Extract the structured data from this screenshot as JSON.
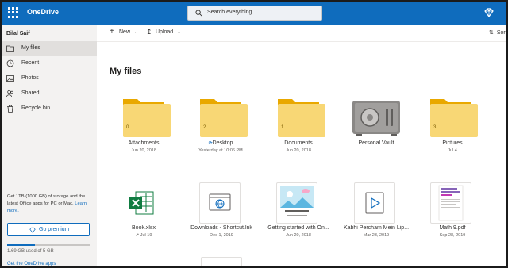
{
  "topbar": {
    "app_name": "OneDrive",
    "search_placeholder": "Search everything"
  },
  "sidebar": {
    "user_name": "Bilal Saif",
    "items": [
      {
        "label": "My files",
        "icon": "folder-icon",
        "active": true
      },
      {
        "label": "Recent",
        "icon": "clock-icon"
      },
      {
        "label": "Photos",
        "icon": "photo-icon"
      },
      {
        "label": "Shared",
        "icon": "people-icon"
      },
      {
        "label": "Recycle bin",
        "icon": "trash-icon"
      }
    ],
    "storage_text": "Get 1TB (1000 GB) of storage and the latest Office apps for PC or Mac.",
    "learn_more": "Learn more.",
    "go_premium": "Go premium",
    "storage_used": "1.69 GB used of 5 GB",
    "storage_fraction": 0.338,
    "get_apps": "Get the OneDrive apps"
  },
  "commandbar": {
    "new_label": "New",
    "upload_label": "Upload",
    "sort_label": "Sor"
  },
  "main": {
    "title": "My files",
    "folders": [
      {
        "name": "Attachments",
        "date": "Jun 20, 2018",
        "count": "0"
      },
      {
        "name": "Desktop",
        "date": "Yesterday at 10:06 PM",
        "count": "2"
      },
      {
        "name": "Documents",
        "date": "Jun 20, 2018",
        "count": "1"
      },
      {
        "name": "Personal Vault",
        "date": ""
      },
      {
        "name": "Pictures",
        "date": "Jul 4",
        "count": "3"
      }
    ],
    "files": [
      {
        "name": "Book.xlsx",
        "date": "Jul 19"
      },
      {
        "name": "Downloads - Shortcut.lnk",
        "date": "Dec 1, 2019"
      },
      {
        "name": "Getting started with On...",
        "date": "Jun 20, 2018"
      },
      {
        "name": "Kabhi Percham Mein Lip...",
        "date": "Mar 23, 2019"
      },
      {
        "name": "Math 9.pdf",
        "date": "Sep 28, 2019"
      }
    ]
  },
  "colors": {
    "accent": "#0f6cbd",
    "folder": "#f8d775",
    "folder_tab": "#e9a800",
    "excel": "#107c41"
  }
}
